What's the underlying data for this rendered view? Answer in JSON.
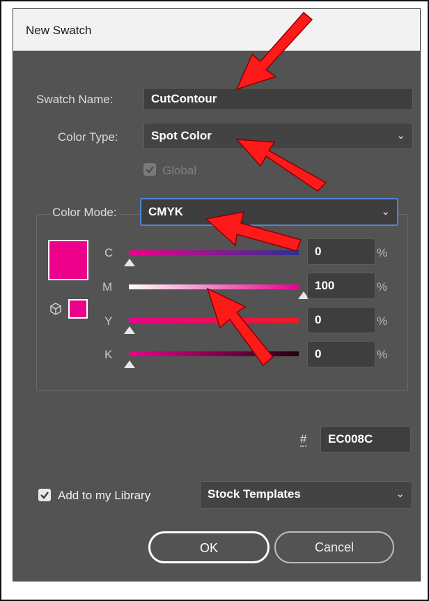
{
  "dialog": {
    "title": "New Swatch"
  },
  "swatch_name": {
    "label": "Swatch Name:",
    "value": "CutContour"
  },
  "color_type": {
    "label": "Color Type:",
    "value": "Spot Color"
  },
  "global": {
    "label": "Global",
    "checked": true,
    "disabled": true
  },
  "color_mode": {
    "label": "Color Mode:",
    "value": "CMYK"
  },
  "channels": [
    {
      "letter": "C",
      "value": "0",
      "unit": "%",
      "level": 0
    },
    {
      "letter": "M",
      "value": "100",
      "unit": "%",
      "level": 100
    },
    {
      "letter": "Y",
      "value": "0",
      "unit": "%",
      "level": 0
    },
    {
      "letter": "K",
      "value": "0",
      "unit": "%",
      "level": 0
    }
  ],
  "hex": {
    "label": "#",
    "value": "EC008C"
  },
  "library": {
    "label": "Add to my Library",
    "checked": true,
    "selected": "Stock Templates"
  },
  "buttons": {
    "ok": "OK",
    "cancel": "Cancel"
  },
  "colors": {
    "swatch": "#EC008C",
    "dialog_bg": "#535353",
    "focus": "#4F86D8",
    "annotation_arrow": "#FF0000"
  },
  "icons": {
    "dropdown": "chevron-down-icon",
    "checkbox": "checkmark-icon",
    "proof": "cube-icon",
    "annotation": "red-arrow-icon"
  }
}
